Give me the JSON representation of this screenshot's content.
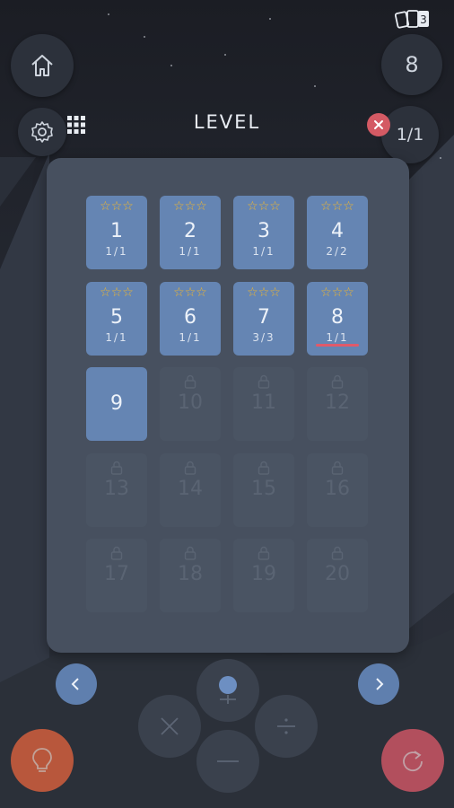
{
  "header": {
    "title": "LEVEL",
    "move_count": "8",
    "progress": "1/1",
    "deck_icon_label": "3"
  },
  "levels": [
    {
      "number": "1",
      "score": "1/1",
      "stars": "☆☆☆",
      "locked": false
    },
    {
      "number": "2",
      "score": "1/1",
      "stars": "☆☆☆",
      "locked": false
    },
    {
      "number": "3",
      "score": "1/1",
      "stars": "☆☆☆",
      "locked": false
    },
    {
      "number": "4",
      "score": "2/2",
      "stars": "☆☆☆",
      "locked": false
    },
    {
      "number": "5",
      "score": "1/1",
      "stars": "☆☆☆",
      "locked": false
    },
    {
      "number": "6",
      "score": "1/1",
      "stars": "☆☆☆",
      "locked": false
    },
    {
      "number": "7",
      "score": "3/3",
      "stars": "☆☆☆",
      "locked": false
    },
    {
      "number": "8",
      "score": "1/1",
      "stars": "☆☆☆",
      "locked": false
    },
    {
      "number": "9",
      "locked": false,
      "current": true
    },
    {
      "number": "10",
      "locked": true
    },
    {
      "number": "11",
      "locked": true
    },
    {
      "number": "12",
      "locked": true
    },
    {
      "number": "13",
      "locked": true
    },
    {
      "number": "14",
      "locked": true
    },
    {
      "number": "15",
      "locked": true
    },
    {
      "number": "16",
      "locked": true
    },
    {
      "number": "17",
      "locked": true
    },
    {
      "number": "18",
      "locked": true
    },
    {
      "number": "19",
      "locked": true
    },
    {
      "number": "20",
      "locked": true
    }
  ],
  "icons": {
    "home": "home-icon",
    "settings": "gear-icon",
    "grid": "grid-icon",
    "close": "close-icon",
    "lock": "lock-icon",
    "prev": "chevron-left-icon",
    "next": "chevron-right-icon",
    "hint": "lightbulb-icon",
    "reset": "restart-icon"
  },
  "colors": {
    "tile_open": "#6585b3",
    "tile_locked": "#4a5463",
    "star": "#f2b72c",
    "accent_red": "#e05a6a",
    "hint_orange": "#e8643e"
  }
}
